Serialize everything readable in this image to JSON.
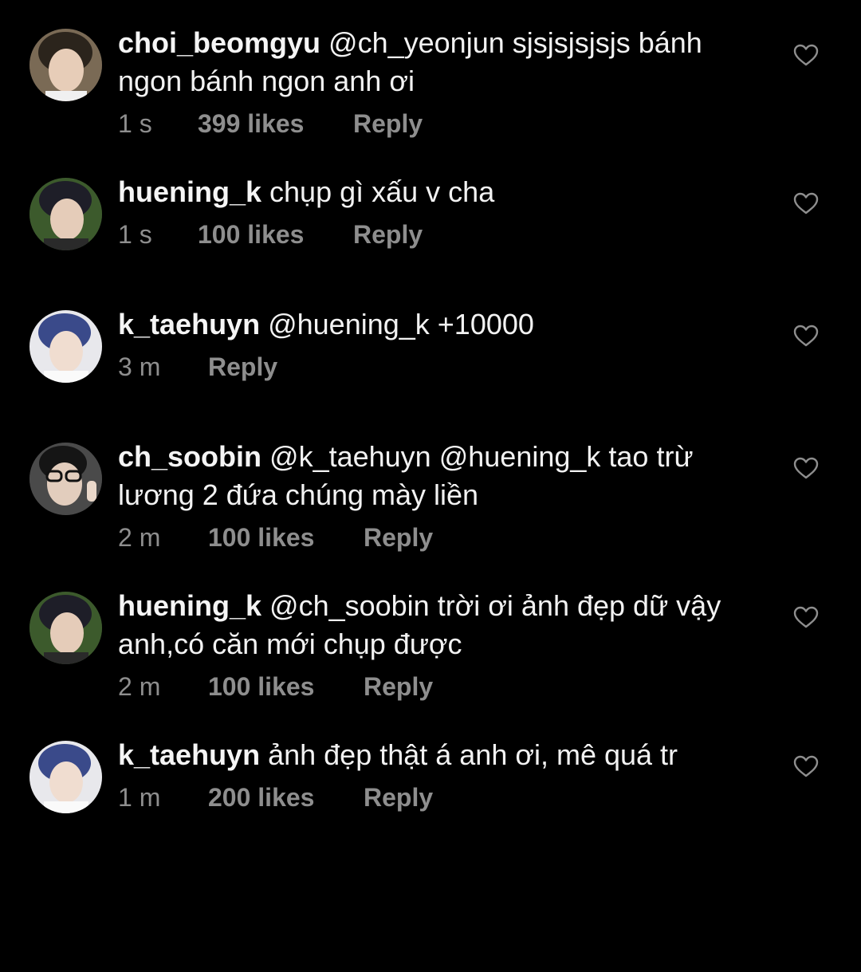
{
  "icons": {
    "like": "heart-outline-icon"
  },
  "colors": {
    "background": "#000000",
    "text": "#f2f2f2",
    "meta": "#8e8e8e"
  },
  "comments": [
    {
      "username": "choi_beomgyu",
      "text": "@ch_yeonjun sjsjsjsjsjs bánh ngon bánh ngon anh ơi",
      "time": "1 s",
      "likes": "399 likes",
      "reply": "Reply"
    },
    {
      "username": "huening_k",
      "text": "chụp gì xấu v cha",
      "time": "1 s",
      "likes": "100 likes",
      "reply": "Reply"
    },
    {
      "username": "k_taehuyn",
      "text": "@huening_k +10000",
      "time": "3 m",
      "reply": "Reply"
    },
    {
      "username": "ch_soobin",
      "text": "@k_taehuyn @huening_k tao trừ lương 2 đứa chúng mày liền",
      "time": "2 m",
      "likes": "100 likes",
      "reply": "Reply"
    },
    {
      "username": "huening_k",
      "text": "@ch_soobin trời ơi ảnh đẹp dữ vậy anh,có căn mới chụp được",
      "time": "2 m",
      "likes": "100 likes",
      "reply": "Reply"
    },
    {
      "username": "k_taehuyn",
      "text": "ảnh đẹp thật á anh ơi, mê quá tr",
      "time": "1 m",
      "likes": "200 likes",
      "reply": "Reply"
    }
  ]
}
